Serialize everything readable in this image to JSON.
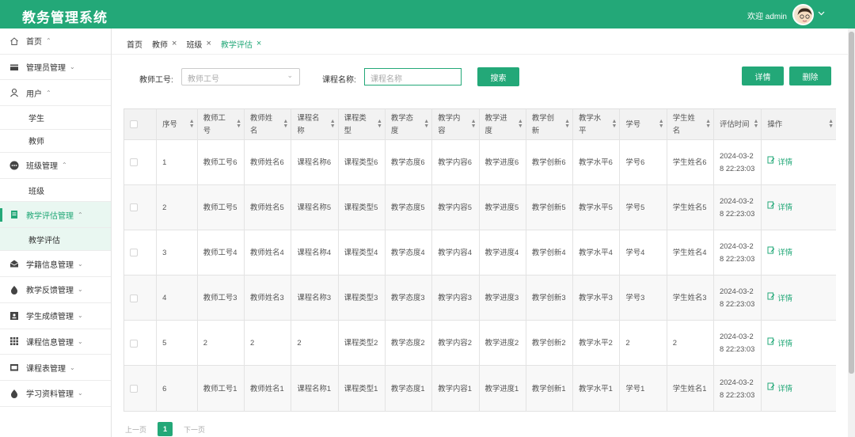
{
  "header": {
    "title": "教务管理系统",
    "welcome": "欢迎 admin"
  },
  "sidebar": {
    "items": [
      {
        "label": "首页",
        "caret": "^",
        "icon": "home-icon"
      },
      {
        "label": "管理员管理",
        "caret": "v",
        "icon": "card-icon"
      },
      {
        "label": "用户",
        "caret": "^",
        "icon": "user-icon"
      }
    ],
    "user_subs": [
      "学生",
      "教师"
    ],
    "class_mgmt": {
      "label": "班级管理",
      "caret": "^",
      "icon": "dots-icon",
      "sub": "班级"
    },
    "eval_mgmt": {
      "label": "教学评估管理",
      "caret": "^",
      "icon": "doc-icon",
      "sub": "教学评估"
    },
    "more": [
      {
        "label": "学籍信息管理",
        "caret": "v",
        "icon": "mail-icon"
      },
      {
        "label": "教学反馈管理",
        "caret": "v",
        "icon": "drop-icon"
      },
      {
        "label": "学生成绩管理",
        "caret": "v",
        "icon": "id-icon"
      },
      {
        "label": "课程信息管理",
        "caret": "v",
        "icon": "grid-icon"
      },
      {
        "label": "课程表管理",
        "caret": "v",
        "icon": "book-icon"
      },
      {
        "label": "学习资料管理",
        "caret": "v",
        "icon": "drop-icon"
      }
    ]
  },
  "tabs": [
    {
      "label": "首页",
      "closable": false
    },
    {
      "label": "教师",
      "closable": true
    },
    {
      "label": "班级",
      "closable": true
    },
    {
      "label": "教学评估",
      "closable": true
    }
  ],
  "tab_close": "×",
  "filters": {
    "teacher_no_label": "教师工号:",
    "teacher_no_placeholder": "教师工号",
    "course_label": "课程名称:",
    "course_placeholder": "课程名称",
    "search_btn": "搜索",
    "detail_btn": "详情",
    "delete_btn": "删除"
  },
  "table": {
    "headers": [
      "序号",
      "教师工号",
      "教师姓名",
      "课程名称",
      "课程类型",
      "教学态度",
      "教学内容",
      "教学进度",
      "教学创新",
      "教学水平",
      "学号",
      "学生姓名",
      "评估时间",
      "操作"
    ],
    "op_label": "详情",
    "rows": [
      [
        "1",
        "教师工号6",
        "教师姓名6",
        "课程名称6",
        "课程类型6",
        "教学态度6",
        "教学内容6",
        "教学进度6",
        "教学创新6",
        "教学水平6",
        "学号6",
        "学生姓名6",
        "2024-03-28 22:23:03"
      ],
      [
        "2",
        "教师工号5",
        "教师姓名5",
        "课程名称5",
        "课程类型5",
        "教学态度5",
        "教学内容5",
        "教学进度5",
        "教学创新5",
        "教学水平5",
        "学号5",
        "学生姓名5",
        "2024-03-28 22:23:03"
      ],
      [
        "3",
        "教师工号4",
        "教师姓名4",
        "课程名称4",
        "课程类型4",
        "教学态度4",
        "教学内容4",
        "教学进度4",
        "教学创新4",
        "教学水平4",
        "学号4",
        "学生姓名4",
        "2024-03-28 22:23:03"
      ],
      [
        "4",
        "教师工号3",
        "教师姓名3",
        "课程名称3",
        "课程类型3",
        "教学态度3",
        "教学内容3",
        "教学进度3",
        "教学创新3",
        "教学水平3",
        "学号3",
        "学生姓名3",
        "2024-03-28 22:23:03"
      ],
      [
        "5",
        "2",
        "2",
        "2",
        "课程类型2",
        "教学态度2",
        "教学内容2",
        "教学进度2",
        "教学创新2",
        "教学水平2",
        "2",
        "2",
        "2024-03-28 22:23:03"
      ],
      [
        "6",
        "教师工号1",
        "教师姓名1",
        "课程名称1",
        "课程类型1",
        "教学态度1",
        "教学内容1",
        "教学进度1",
        "教学创新1",
        "教学水平1",
        "学号1",
        "学生姓名1",
        "2024-03-28 22:23:03"
      ]
    ]
  },
  "pager": {
    "prev": "上一页",
    "current": "1",
    "next": "下一页"
  },
  "colors": {
    "accent": "#23a878"
  }
}
